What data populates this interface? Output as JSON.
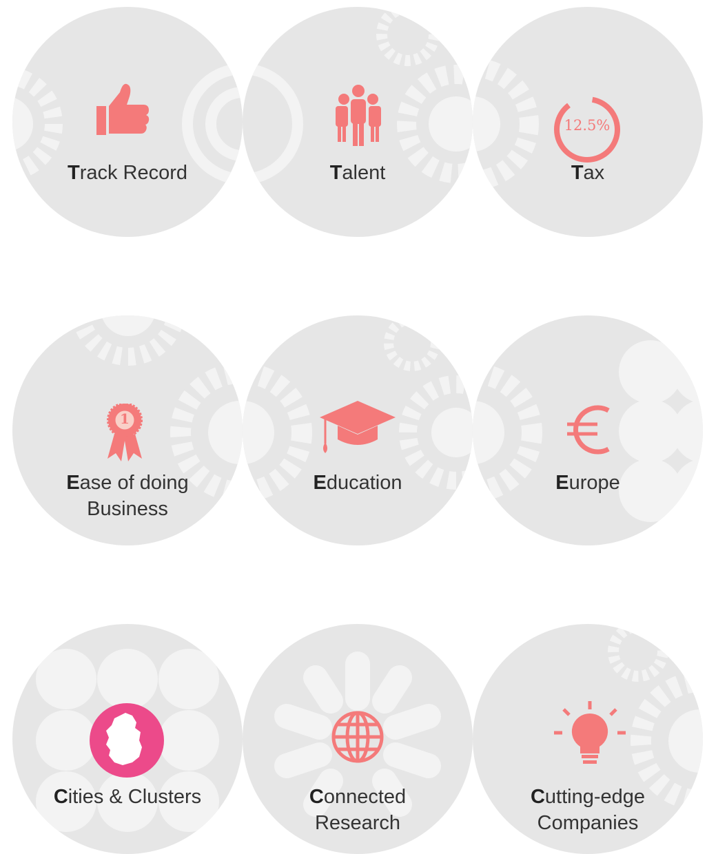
{
  "colors": {
    "circle_bg": "#e6e6e6",
    "decor": "#f3f3f3",
    "icon_coral": "#f47a7a",
    "icon_pink": "#ec4a8a",
    "text": "#333333"
  },
  "items": [
    {
      "initial": "T",
      "rest": "rack Record",
      "icon": "thumbs-up-icon"
    },
    {
      "initial": "T",
      "rest": "alent",
      "icon": "people-group-icon"
    },
    {
      "initial": "T",
      "rest": "ax",
      "icon": "tax-rate-icon",
      "icon_text": "12.5%"
    },
    {
      "initial": "E",
      "rest": "ase of doing",
      "line2": "Business",
      "icon": "award-ribbon-icon",
      "icon_text": "1"
    },
    {
      "initial": "E",
      "rest": "ducation",
      "icon": "graduation-cap-icon"
    },
    {
      "initial": "E",
      "rest": "urope",
      "icon": "euro-icon"
    },
    {
      "initial": "C",
      "rest": "ities & Clusters",
      "icon": "ireland-map-icon"
    },
    {
      "initial": "C",
      "rest": "onnected",
      "line2": "Research",
      "icon": "globe-icon"
    },
    {
      "initial": "C",
      "rest": "utting-edge",
      "line2": "Companies",
      "icon": "lightbulb-icon"
    }
  ]
}
